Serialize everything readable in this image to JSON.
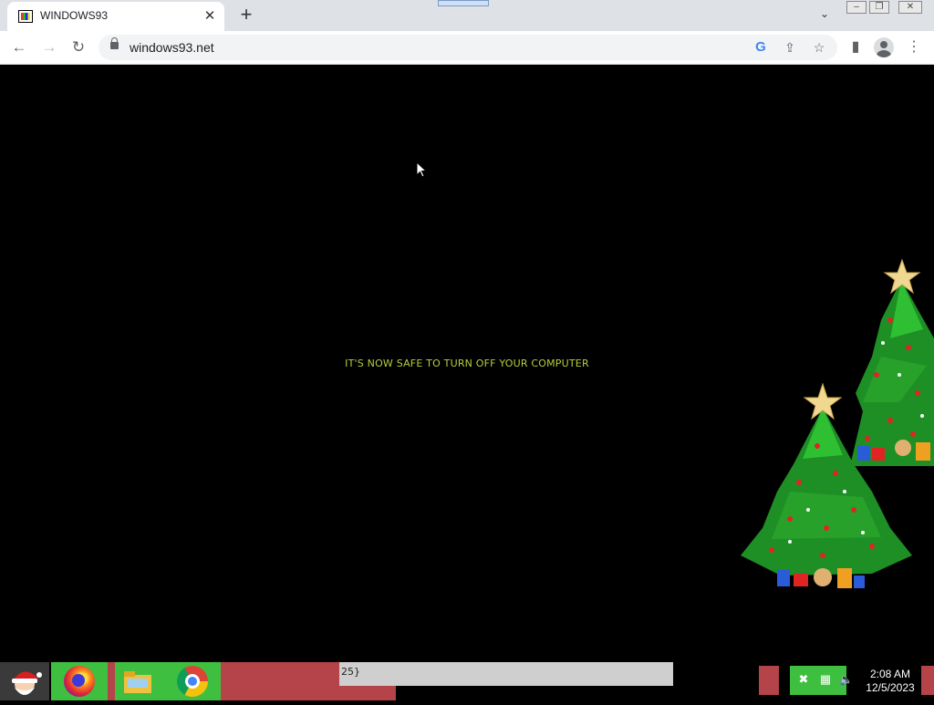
{
  "browser": {
    "tab": {
      "title": "WINDOWS93",
      "favicon": "windows93-flag-icon"
    },
    "window_controls": [
      "minimize-icon",
      "restore-icon",
      "close-icon"
    ],
    "url": "windows93.net"
  },
  "page": {
    "message": "IT'S NOW SAFE TO TURN OFF YOUR COMPUTER",
    "message_color": "#b9cd3c",
    "background": "#000000"
  },
  "taskbar": {
    "start_icon": "santa-icon",
    "apps": [
      "firefox-icon",
      "folder-icon",
      "chrome-icon"
    ],
    "ticker_text": "25}",
    "tray_icons": [
      "network-error-icon",
      "network-icon"
    ],
    "clock": {
      "time": "2:08 AM",
      "date": "12/5/2023"
    }
  }
}
